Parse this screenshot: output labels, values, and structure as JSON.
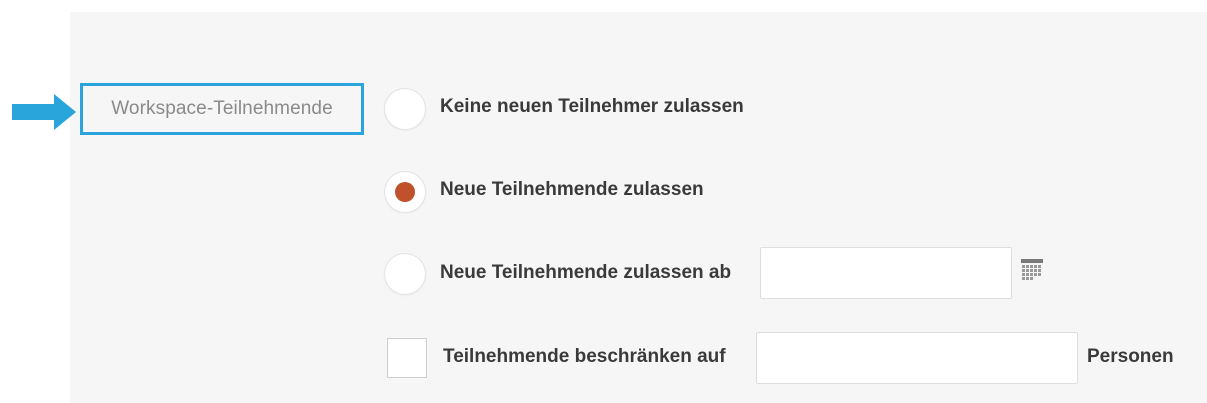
{
  "section": {
    "label": "Workspace-Teilnehmende"
  },
  "options": [
    {
      "label": "Keine neuen Teilnehmer zulassen",
      "selected": false
    },
    {
      "label": "Neue Teilnehmende zulassen",
      "selected": true
    },
    {
      "label": "Neue Teilnehmende zulassen ab",
      "selected": false
    }
  ],
  "date_field": {
    "value": "",
    "icon": "calendar-icon"
  },
  "limit": {
    "label": "Teilnehmende beschränken auf",
    "checked": false,
    "value": "",
    "unit": "Personen"
  },
  "colors": {
    "highlight_border": "#29a5dc",
    "arrow": "#29a5dc",
    "radio_selected": "#c0512a",
    "panel_bg": "#f6f6f6"
  }
}
